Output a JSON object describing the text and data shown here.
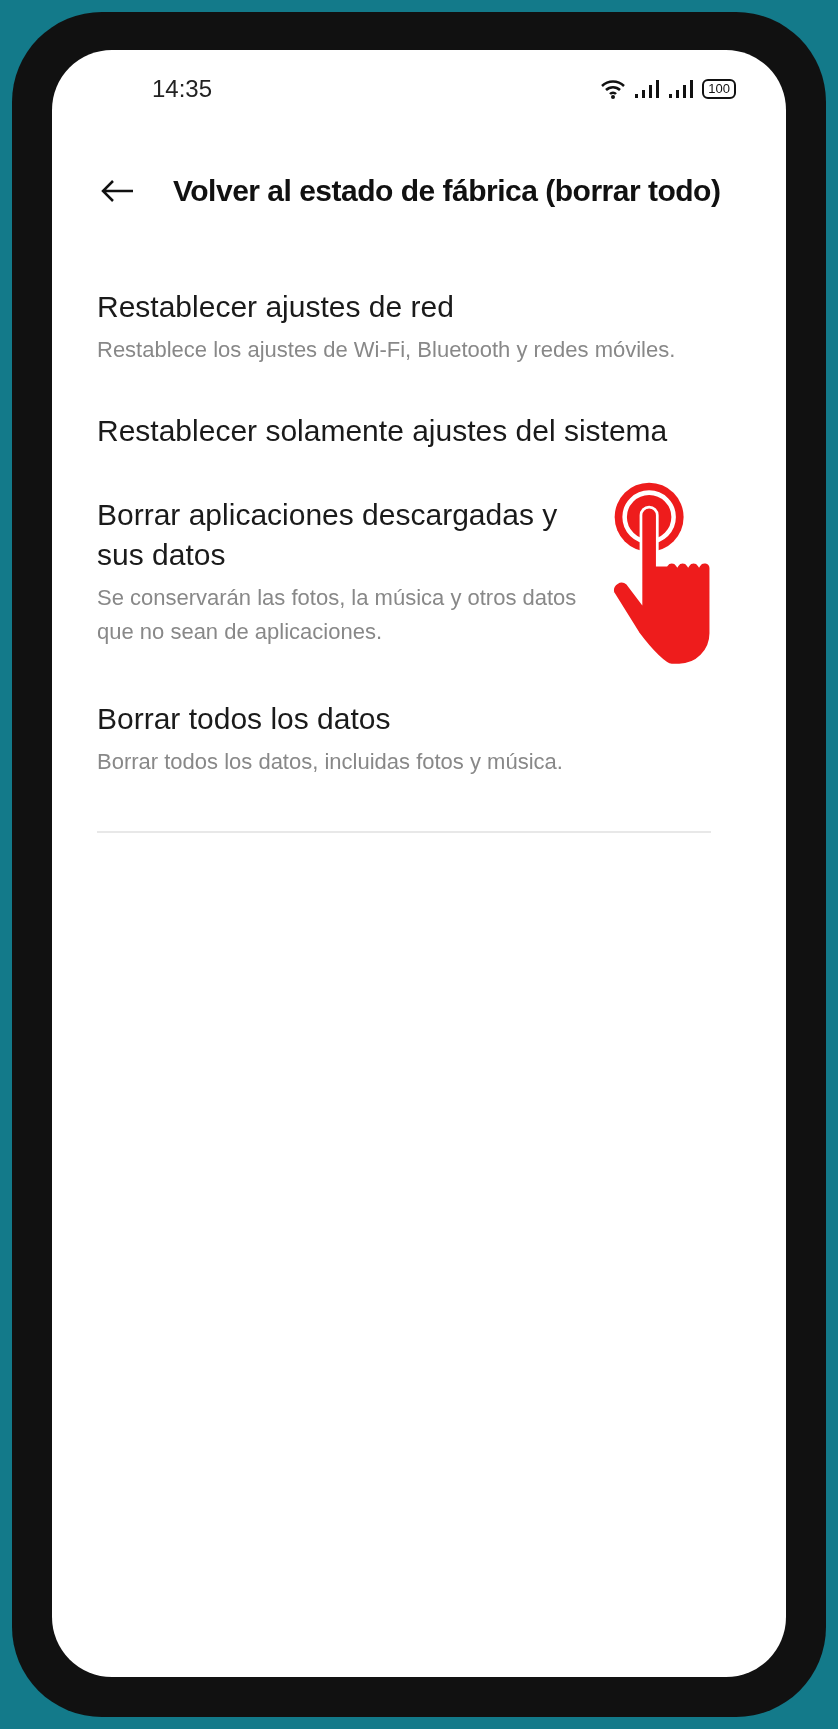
{
  "status_bar": {
    "time": "14:35",
    "battery": "100"
  },
  "header": {
    "title": "Volver al estado de fábrica (borrar todo)"
  },
  "options": [
    {
      "title": "Restablecer ajustes de red",
      "description": "Restablece los ajustes de Wi-Fi, Bluetooth y redes móviles.",
      "tapped": false
    },
    {
      "title": "Restablecer solamente ajustes del sistema",
      "tapped": false
    },
    {
      "title": "Borrar aplicaciones descargadas y sus datos",
      "description": "Se conservarán las fotos, la música y otros datos que no sean de aplicaciones.",
      "tapped": true
    },
    {
      "title": "Borrar todos los datos",
      "description": "Borrar todos los datos, incluidas fotos y música.",
      "tapped": false
    }
  ]
}
